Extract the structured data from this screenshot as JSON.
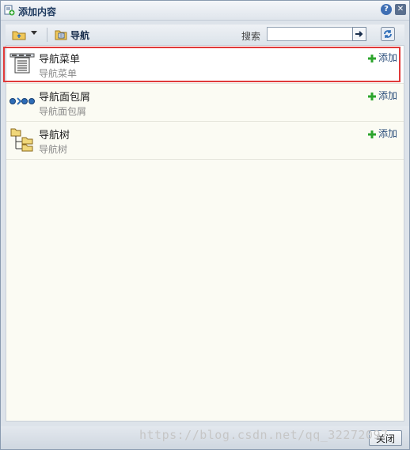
{
  "window": {
    "title": "添加内容",
    "help_label": "?",
    "close_label": "✕"
  },
  "toolbar": {
    "nav_label": "导航",
    "search_label": "搜索",
    "search_value": ""
  },
  "items": [
    {
      "title": "导航菜单",
      "desc": "导航菜单",
      "add_label": "添加",
      "icon": "menu-icon"
    },
    {
      "title": "导航面包屑",
      "desc": "导航面包屑",
      "add_label": "添加",
      "icon": "breadcrumb-icon"
    },
    {
      "title": "导航树",
      "desc": "导航树",
      "add_label": "添加",
      "icon": "tree-icon"
    }
  ],
  "footer": {
    "close_button_label": "关闭",
    "watermark": "https://blog.csdn.net/qq_32272097"
  },
  "colors": {
    "highlight_border": "#e03a3a",
    "list_background": "#fbfbf3",
    "link": "#2a4d7a",
    "plus": "#2da52d"
  }
}
